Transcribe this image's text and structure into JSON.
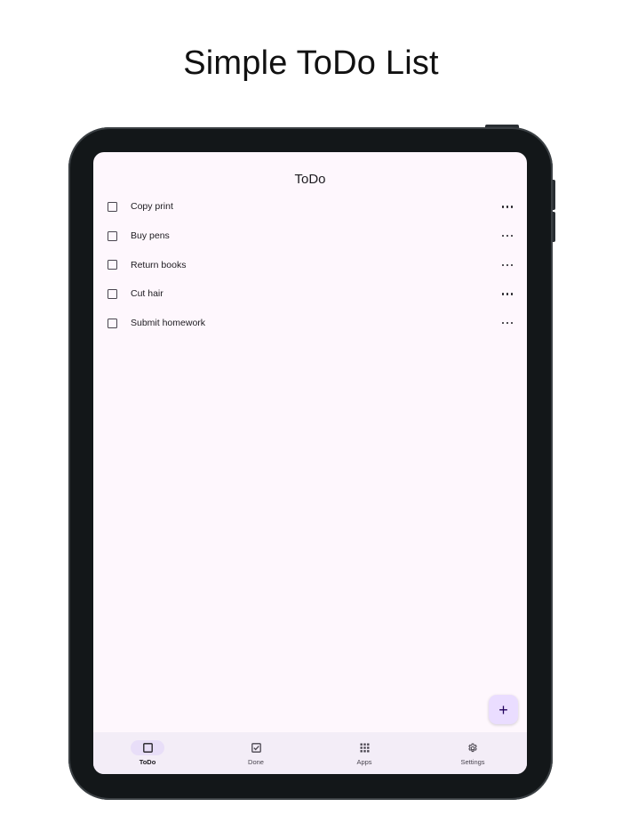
{
  "promo": {
    "title": "Simple ToDo List"
  },
  "app": {
    "title": "ToDo"
  },
  "todos": [
    {
      "label": "Copy print",
      "checked": false
    },
    {
      "label": "Buy pens",
      "checked": false
    },
    {
      "label": "Return books",
      "checked": false
    },
    {
      "label": "Cut hair",
      "checked": false
    },
    {
      "label": "Submit homework",
      "checked": false
    }
  ],
  "fab": {
    "icon": "plus-icon",
    "glyph": "+"
  },
  "nav": {
    "items": [
      {
        "label": "ToDo",
        "icon": "checkbox-blank-icon",
        "active": true
      },
      {
        "label": "Done",
        "icon": "checkbox-checked-icon",
        "active": false
      },
      {
        "label": "Apps",
        "icon": "apps-grid-icon",
        "active": false
      },
      {
        "label": "Settings",
        "icon": "gear-icon",
        "active": false
      }
    ]
  },
  "colors": {
    "screen_bg": "#fef7fd",
    "navbar_bg": "#f3edf7",
    "nav_active_pill": "#e8def8",
    "fab_bg": "#eaddff",
    "device_frame": "#131719"
  }
}
